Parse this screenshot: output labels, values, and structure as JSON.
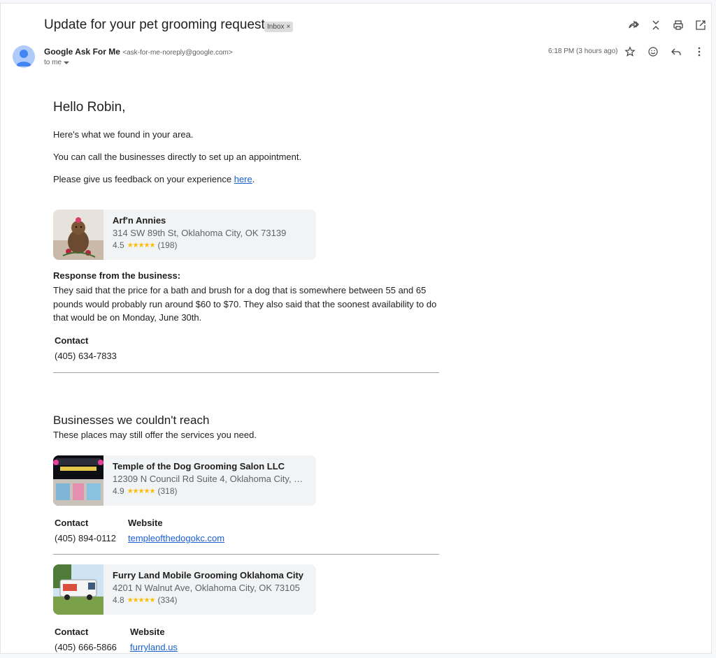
{
  "header": {
    "subject": "Update for your pet grooming request",
    "label_chip": "Inbox",
    "label_chip_close": "×"
  },
  "sender": {
    "name": "Google Ask For Me",
    "address": "<ask-for-me-noreply@google.com>",
    "to": "to me",
    "time": "6:18 PM (3 hours ago)"
  },
  "message": {
    "greeting": "Hello Robin,",
    "line1": "Here's what we found in your area.",
    "line2": "You can call the businesses directly to set up an appointment.",
    "line3_prefix": "Please give us feedback on your experience ",
    "line3_link": "here",
    "line3_suffix": "."
  },
  "business1": {
    "name": "Arf'n Annies",
    "address": "314 SW 89th St, Oklahoma City, OK 73139",
    "rating": "4.5",
    "stars": "★★★★★",
    "reviews": "(198)",
    "response_label": "Response from the business:",
    "response_text": "They said that the price for a bath and brush for a dog that is somewhere between 55 and 65 pounds would probably run around $60 to $70. They also said that the soonest availability to do that would be on Monday, June 30th.",
    "contact_label": "Contact",
    "phone": "(405) 634-7833"
  },
  "unreached": {
    "title": "Businesses we couldn't reach",
    "subtitle": "These places may still offer the services you need."
  },
  "business2": {
    "name": "Temple of the Dog Grooming Salon LLC",
    "address": "12309 N Council Rd Suite 4, Oklahoma City, O...",
    "rating": "4.9",
    "stars": "★★★★★",
    "reviews": "(318)",
    "contact_label": "Contact",
    "phone": "(405) 894-0112",
    "website_label": "Website",
    "website": "templeofthedogokc.com"
  },
  "business3": {
    "name": "Furry Land Mobile Grooming Oklahoma City",
    "address": "4201 N Walnut Ave, Oklahoma City, OK 73105",
    "rating": "4.8",
    "stars": "★★★★★",
    "reviews": "(334)",
    "contact_label": "Contact",
    "phone": "(405) 666-5866",
    "website_label": "Website",
    "website": "furryland.us"
  },
  "colors": {
    "link": "#1a5fd1",
    "star": "#fbbc04",
    "card_bg": "#f1f3f4",
    "avatar_bg": "#aecbfa"
  }
}
